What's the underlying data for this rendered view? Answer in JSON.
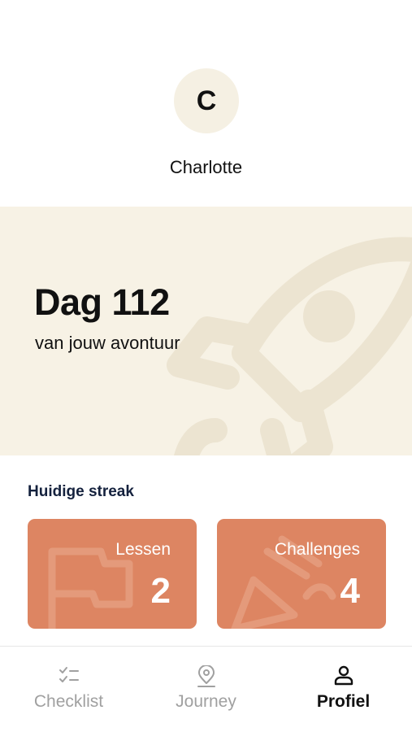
{
  "profile": {
    "avatar_initial": "C",
    "name": "Charlotte"
  },
  "hero": {
    "title": "Dag 112",
    "subtitle": "van jouw avontuur",
    "background_color": "#f7f2e5",
    "watermark_icon": "rocket-icon"
  },
  "streak": {
    "section_title": "Huidige streak",
    "card_color": "#dd8562",
    "cards": [
      {
        "label": "Lessen",
        "value": "2",
        "icon": "flag-icon"
      },
      {
        "label": "Challenges",
        "value": "4",
        "icon": "party-popper-icon"
      }
    ]
  },
  "nav": {
    "active": "Profiel",
    "items": [
      {
        "label": "Checklist",
        "icon": "checklist-icon"
      },
      {
        "label": "Journey",
        "icon": "map-pin-icon"
      },
      {
        "label": "Profiel",
        "icon": "user-icon"
      }
    ]
  }
}
